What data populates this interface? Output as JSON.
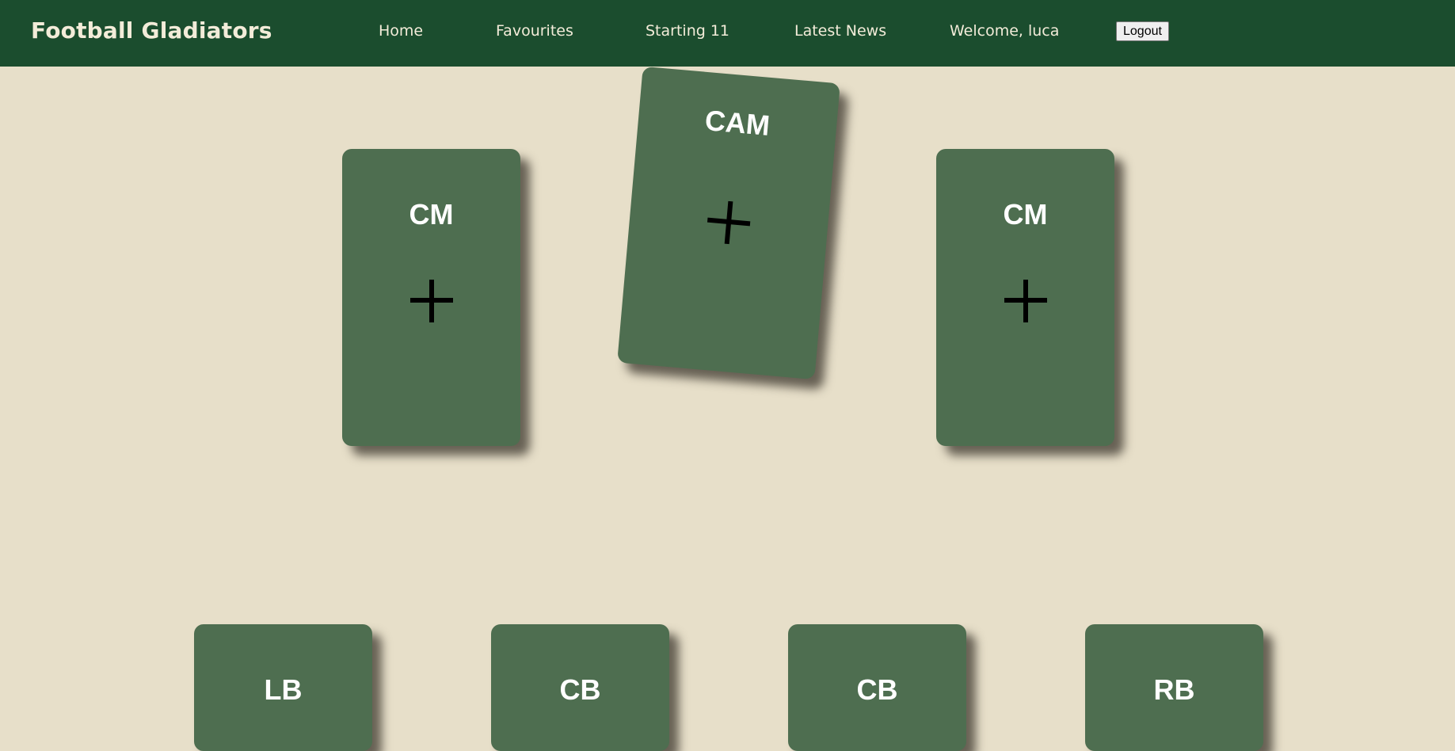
{
  "header": {
    "brand": "Football Gladiators",
    "nav": {
      "home": "Home",
      "favourites": "Favourites",
      "starting11": "Starting 11",
      "latest_news": "Latest News"
    },
    "welcome": "Welcome, luca",
    "logout_label": "Logout"
  },
  "lineup": {
    "midfield": [
      {
        "position": "CM"
      },
      {
        "position": "CAM"
      },
      {
        "position": "CM"
      }
    ],
    "defense": [
      {
        "position": "LB"
      },
      {
        "position": "CB"
      },
      {
        "position": "CB"
      },
      {
        "position": "RB"
      }
    ],
    "add_icon": "plus-icon"
  },
  "colors": {
    "navbar": "#1b4d2e",
    "background": "#e7dfc9",
    "card": "#4e6e50",
    "text_light": "#f3ecd9"
  }
}
